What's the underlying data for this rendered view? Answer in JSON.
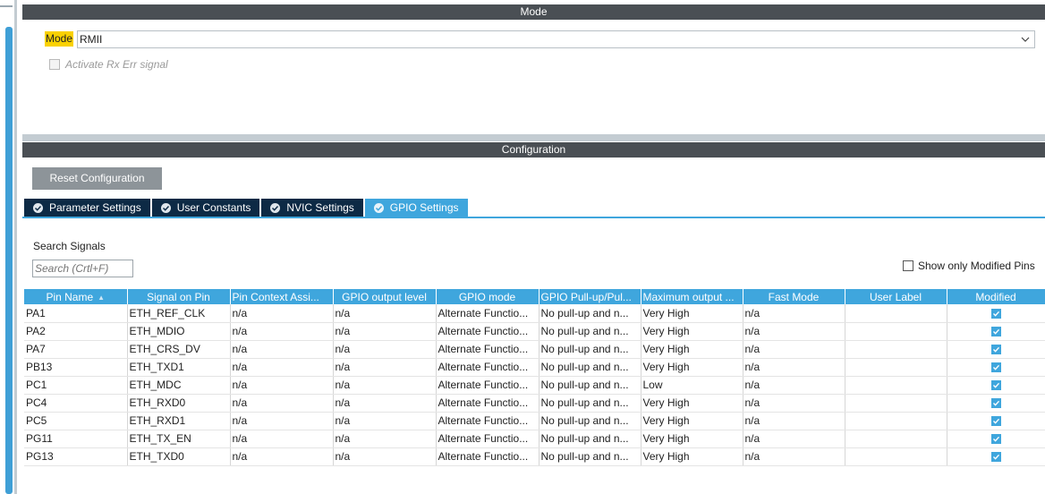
{
  "mode_header": "Mode",
  "mode": {
    "label": "Mode",
    "value": "RMII",
    "rx_err_label": "Activate Rx Err signal"
  },
  "config_header": "Configuration",
  "reset_label": "Reset Configuration",
  "tabs": [
    {
      "label": "Parameter Settings"
    },
    {
      "label": "User Constants"
    },
    {
      "label": "NVIC Settings"
    },
    {
      "label": "GPIO Settings"
    }
  ],
  "search": {
    "label": "Search Signals",
    "placeholder": "Search (Crtl+F)"
  },
  "show_modified_label": "Show only Modified Pins",
  "table": {
    "headers": [
      "Pin Name",
      "Signal on Pin",
      "Pin Context Assi...",
      "GPIO output level",
      "GPIO mode",
      "GPIO Pull-up/Pul...",
      "Maximum output ...",
      "Fast Mode",
      "User Label",
      "Modified"
    ],
    "rows": [
      [
        "PA1",
        "ETH_REF_CLK",
        "n/a",
        "n/a",
        "Alternate Functio...",
        "No pull-up and n...",
        "Very High",
        "n/a",
        "",
        "checked"
      ],
      [
        "PA2",
        "ETH_MDIO",
        "n/a",
        "n/a",
        "Alternate Functio...",
        "No pull-up and n...",
        "Very High",
        "n/a",
        "",
        "checked"
      ],
      [
        "PA7",
        "ETH_CRS_DV",
        "n/a",
        "n/a",
        "Alternate Functio...",
        "No pull-up and n...",
        "Very High",
        "n/a",
        "",
        "checked"
      ],
      [
        "PB13",
        "ETH_TXD1",
        "n/a",
        "n/a",
        "Alternate Functio...",
        "No pull-up and n...",
        "Very High",
        "n/a",
        "",
        "checked"
      ],
      [
        "PC1",
        "ETH_MDC",
        "n/a",
        "n/a",
        "Alternate Functio...",
        "No pull-up and n...",
        "Low",
        "n/a",
        "",
        "checked"
      ],
      [
        "PC4",
        "ETH_RXD0",
        "n/a",
        "n/a",
        "Alternate Functio...",
        "No pull-up and n...",
        "Very High",
        "n/a",
        "",
        "checked"
      ],
      [
        "PC5",
        "ETH_RXD1",
        "n/a",
        "n/a",
        "Alternate Functio...",
        "No pull-up and n...",
        "Very High",
        "n/a",
        "",
        "checked"
      ],
      [
        "PG11",
        "ETH_TX_EN",
        "n/a",
        "n/a",
        "Alternate Functio...",
        "No pull-up and n...",
        "Very High",
        "n/a",
        "",
        "checked"
      ],
      [
        "PG13",
        "ETH_TXD0",
        "n/a",
        "n/a",
        "Alternate Functio...",
        "No pull-up and n...",
        "Very High",
        "n/a",
        "",
        "checked"
      ]
    ]
  },
  "colors": {
    "accent": "#3fa6dd",
    "header_dark": "#4a4f54",
    "tab_dark": "#0d2a45",
    "mode_highlight": "#f9d100"
  }
}
